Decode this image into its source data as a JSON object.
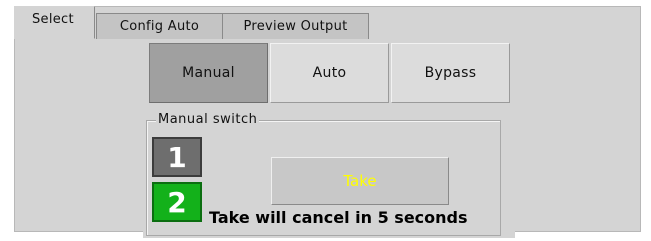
{
  "tabs": [
    {
      "label": "Select",
      "active": true
    },
    {
      "label": "Config Auto",
      "active": false
    },
    {
      "label": "Preview Output",
      "active": false
    }
  ],
  "mode": {
    "buttons": [
      {
        "label": "Manual",
        "selected": true
      },
      {
        "label": "Auto",
        "selected": false
      },
      {
        "label": "Bypass",
        "selected": false
      }
    ]
  },
  "manual_switch": {
    "legend": "Manual switch",
    "sources": [
      {
        "label": "1",
        "active": false,
        "color": "#6e6e6e"
      },
      {
        "label": "2",
        "active": true,
        "color": "#13b11a"
      }
    ],
    "take_label": "Take",
    "take_color": "#ffff00",
    "countdown_text": "Take will cancel in 5 seconds"
  }
}
